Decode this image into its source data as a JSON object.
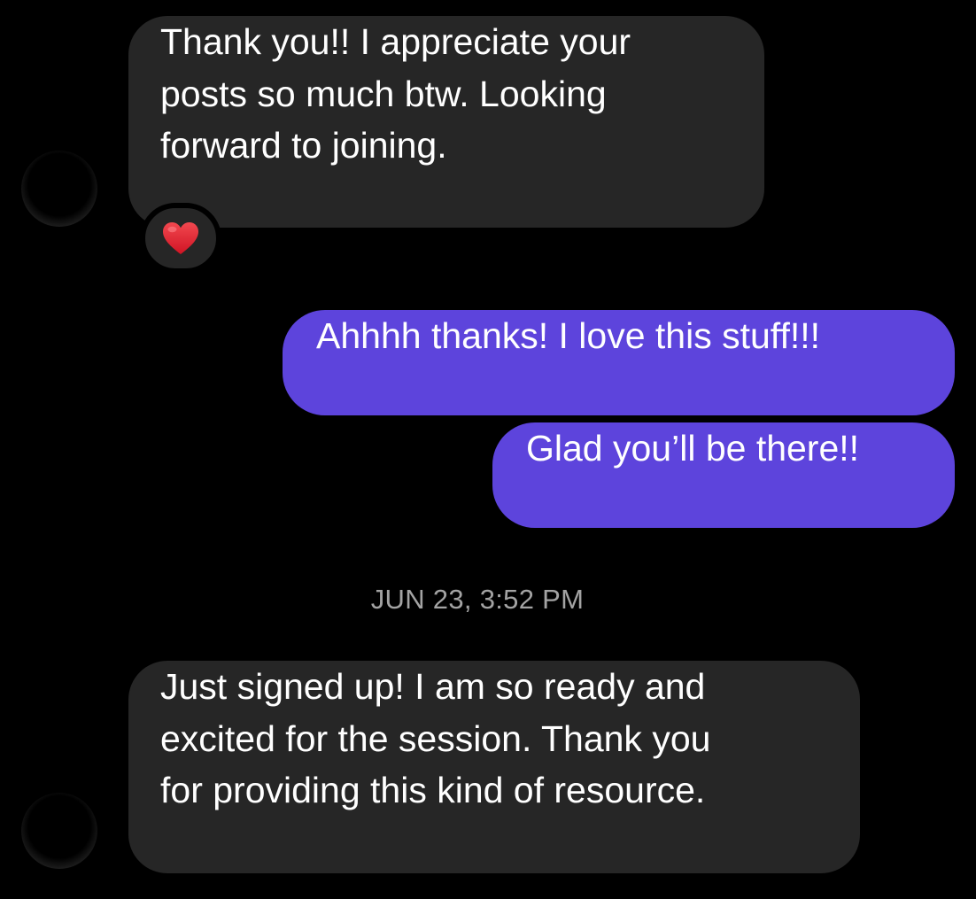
{
  "thread": {
    "messages": [
      {
        "sender": "them",
        "lines": [
          "Thank you!! I appreciate your",
          "posts so much btw. Looking",
          "forward to joining."
        ],
        "reaction": "heart-icon"
      },
      {
        "sender": "me",
        "lines": [
          "Ahhhh thanks! I love this stuff!!!"
        ]
      },
      {
        "sender": "me",
        "lines": [
          "Glad you’ll be there!!"
        ]
      },
      {
        "sender": "them",
        "lines": [
          "Just signed up! I am so ready and",
          "excited for the session. Thank you",
          "for providing this kind of resource."
        ]
      }
    ],
    "timestamp": "JUN 23, 3:52 PM"
  },
  "colors": {
    "background": "#000000",
    "incoming_bubble": "#262626",
    "outgoing_bubble": "#5d44dc",
    "timestamp_text": "#a3a3a3",
    "heart": "#e0202e"
  }
}
